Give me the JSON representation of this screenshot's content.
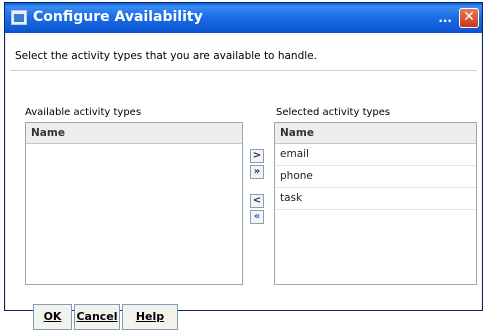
{
  "window": {
    "title": "Configure Availability",
    "title_dots": "...",
    "close_glyph": "✕"
  },
  "instruction": "Select the activity types that you are available to handle.",
  "available": {
    "label": "Available activity types",
    "header": "Name",
    "items": []
  },
  "selected": {
    "label": "Selected activity types",
    "header": "Name",
    "items": [
      "email",
      "phone",
      "task"
    ]
  },
  "move_buttons": {
    "add_one": ">",
    "add_all": "»",
    "remove_one": "<",
    "remove_all": "«"
  },
  "buttons": {
    "ok": "OK",
    "cancel": "Cancel",
    "help": "Help"
  }
}
